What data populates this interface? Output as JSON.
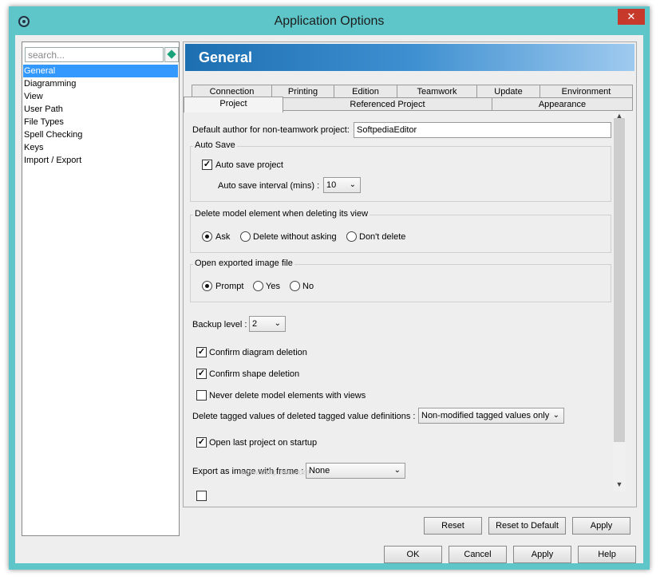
{
  "window": {
    "title": "Application Options"
  },
  "search": {
    "placeholder": "search..."
  },
  "nav": [
    "General",
    "Diagramming",
    "View",
    "User Path",
    "File Types",
    "Spell Checking",
    "Keys",
    "Import / Export"
  ],
  "header": {
    "title": "General"
  },
  "tabs_row1": [
    "Connection",
    "Printing",
    "Edition",
    "Teamwork",
    "Update",
    "Environment"
  ],
  "tabs_row2": [
    "Project",
    "Referenced Project",
    "Appearance"
  ],
  "active_tab": "Project",
  "form": {
    "author_label": "Default author for non-teamwork project:",
    "author_value": "SoftpediaEditor",
    "autosave_legend": "Auto Save",
    "autosave_check": "Auto save project",
    "autosave_interval_label": "Auto save interval (mins) :",
    "autosave_interval_value": "10",
    "delete_legend": "Delete model element when deleting its view",
    "delete_options": [
      "Ask",
      "Delete without asking",
      "Don't delete"
    ],
    "open_legend": "Open exported image file",
    "open_options": [
      "Prompt",
      "Yes",
      "No"
    ],
    "backup_label": "Backup level :",
    "backup_value": "2",
    "confirm_diagram": "Confirm diagram deletion",
    "confirm_shape": "Confirm shape deletion",
    "never_delete": "Never delete model elements with views",
    "delete_tagged_label": "Delete tagged values of deleted tagged value definitions :",
    "delete_tagged_value": "Non-modified tagged values only",
    "open_last": "Open last project on startup",
    "export_frame_label": "Export as image with frame :",
    "export_frame_value": "None"
  },
  "panel_buttons": {
    "reset": "Reset",
    "reset_default": "Reset to Default",
    "apply": "Apply"
  },
  "dialog_buttons": {
    "ok": "OK",
    "cancel": "Cancel",
    "apply": "Apply",
    "help": "Help"
  },
  "watermark": "www.softpedia.com",
  "colors": {
    "titlebar": "#5ec6c8",
    "header_start": "#1c6fb1",
    "selected": "#3399ff",
    "close": "#c7392b"
  }
}
